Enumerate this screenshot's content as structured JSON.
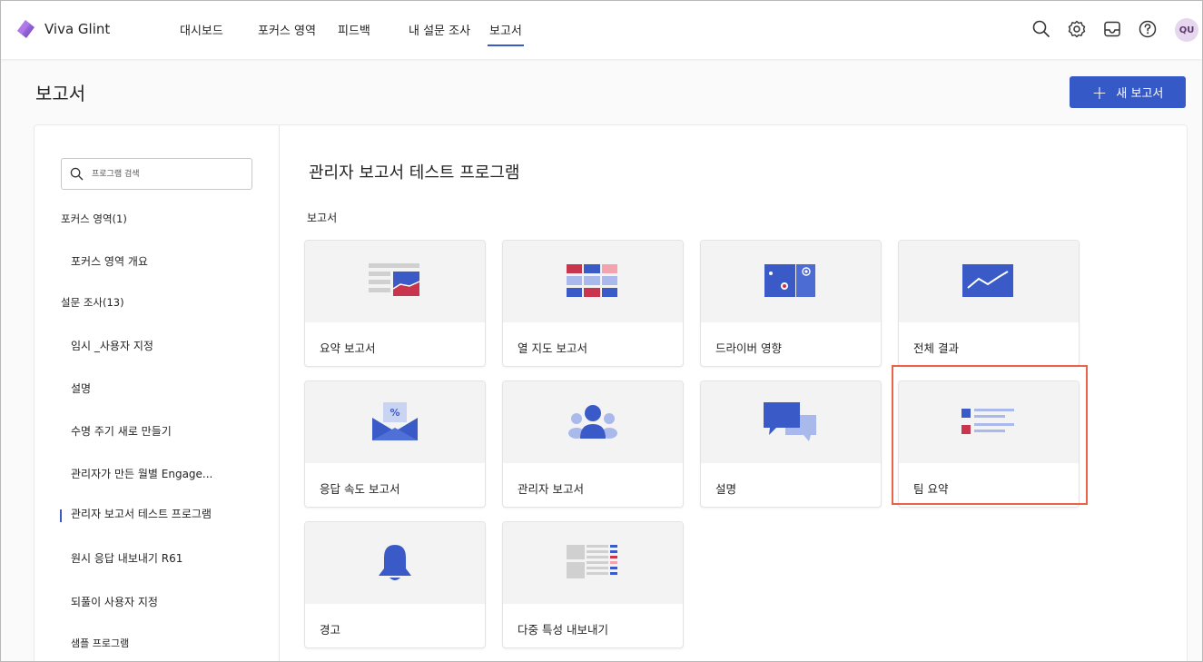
{
  "app": {
    "name": "Viva Glint"
  },
  "nav": {
    "items": [
      "대시보드",
      "포커스 영역",
      "피드백",
      "내 설문 조사",
      "보고서"
    ],
    "active": "보고서"
  },
  "top_icons": [
    "search-icon",
    "gear-icon",
    "inbox-icon",
    "help-icon"
  ],
  "user": {
    "initials": "QU"
  },
  "page": {
    "title": "보고서",
    "new_report_label": "새 보고서"
  },
  "sidebar": {
    "search_placeholder": "프로그램 검색",
    "groups": [
      {
        "label": "포커스 영역(1)",
        "items": [
          "포커스 영역 개요"
        ]
      },
      {
        "label": "설문 조사(13)",
        "items": [
          "임시 _사용자 지정",
          "설명",
          "수명 주기 새로 만들기",
          "관리자가 만든 월별 Engage...",
          "관리자 보고서 테스트 프로그램",
          "원시 응답 내보내기 R61",
          "되풀이 사용자 지정",
          "샘플 프로그램"
        ]
      }
    ],
    "active_item": "관리자 보고서 테스트 프로그램"
  },
  "content": {
    "title": "관리자 보고서 테스트 프로그램",
    "section_label": "보고서",
    "cards": [
      {
        "label": "요약 보고서",
        "icon": "summary-report-icon"
      },
      {
        "label": "열 지도 보고서",
        "icon": "heatmap-icon"
      },
      {
        "label": "드라이버 영향",
        "icon": "driver-impact-icon"
      },
      {
        "label": "전체 결과",
        "icon": "trend-chart-icon"
      },
      {
        "label": "응답 속도 보고서",
        "icon": "response-rate-icon"
      },
      {
        "label": "관리자 보고서",
        "icon": "people-icon"
      },
      {
        "label": "설명",
        "icon": "comments-icon"
      },
      {
        "label": "팀 요약",
        "icon": "team-summary-icon",
        "highlighted": true
      },
      {
        "label": "경고",
        "icon": "bell-icon"
      },
      {
        "label": "다중 특성 내보내기",
        "icon": "multi-export-icon"
      }
    ]
  },
  "colors": {
    "accent": "#3659c8",
    "highlight_box": "#e8634a",
    "brand_purple": "#8a5cd0"
  }
}
